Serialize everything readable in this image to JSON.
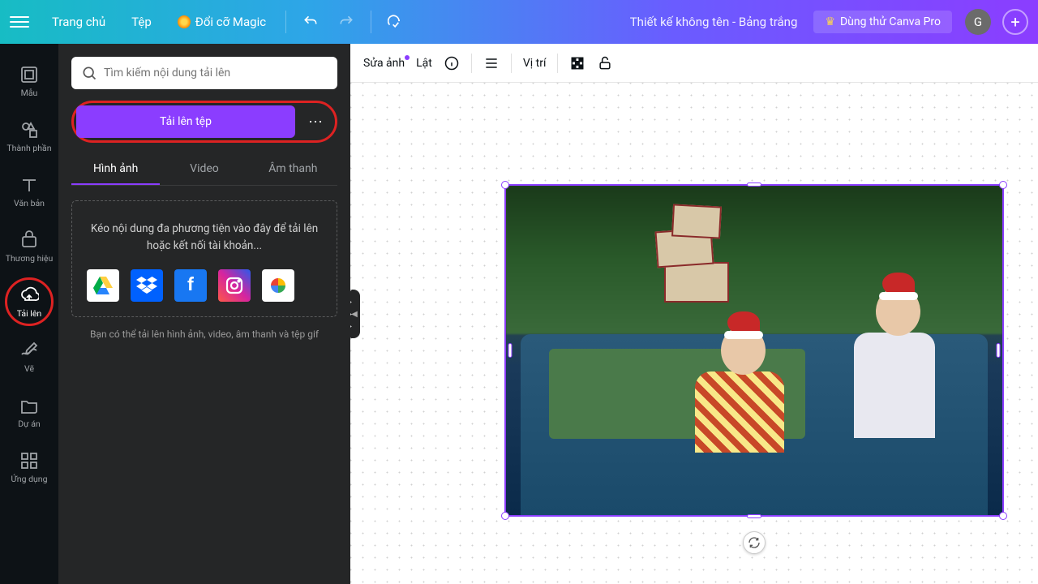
{
  "topbar": {
    "home": "Trang chủ",
    "file": "Tệp",
    "magic": "Đổi cỡ Magic",
    "doc_title": "Thiết kế không tên - Bảng trắng",
    "pro": "Dùng thử Canva Pro",
    "avatar_letter": "G"
  },
  "rail": {
    "templates": "Mẫu",
    "elements": "Thành phần",
    "text": "Văn bản",
    "brand": "Thương hiệu",
    "uploads": "Tải lên",
    "draw": "Vẽ",
    "projects": "Dự án",
    "apps": "Ứng dụng"
  },
  "panel": {
    "search_placeholder": "Tìm kiếm nội dung tải lên",
    "upload_btn": "Tải lên tệp",
    "tabs": {
      "images": "Hình ảnh",
      "video": "Video",
      "audio": "Âm thanh"
    },
    "drop_text": "Kéo nội dung đa phương tiện vào đây để tải lên hoặc kết nối tài khoản...",
    "hint": "Bạn có thể tải lên hình ảnh, video, âm thanh và tệp gif",
    "services": [
      "Google Drive",
      "Dropbox",
      "Facebook",
      "Instagram",
      "Google Photos"
    ]
  },
  "context": {
    "edit_image": "Sửa ảnh",
    "flip": "Lật",
    "position": "Vị trí"
  }
}
